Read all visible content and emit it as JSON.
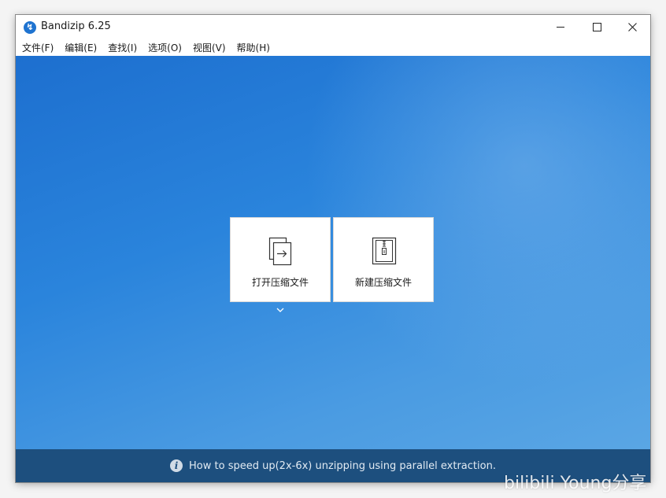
{
  "window": {
    "title": "Bandizip 6.25",
    "app_icon_glyph": "↯"
  },
  "menu": {
    "items": [
      {
        "label": "文件(F)"
      },
      {
        "label": "编辑(E)"
      },
      {
        "label": "查找(I)"
      },
      {
        "label": "选项(O)"
      },
      {
        "label": "视图(V)"
      },
      {
        "label": "帮助(H)"
      }
    ]
  },
  "main": {
    "open_archive_label": "打开压缩文件",
    "new_archive_label": "新建压缩文件",
    "accent_color": "#1e73d0"
  },
  "status": {
    "info_glyph": "i",
    "tip": "How to speed up(2x-6x) unzipping using parallel extraction."
  },
  "watermark": {
    "text": "bilibili Young分享"
  }
}
